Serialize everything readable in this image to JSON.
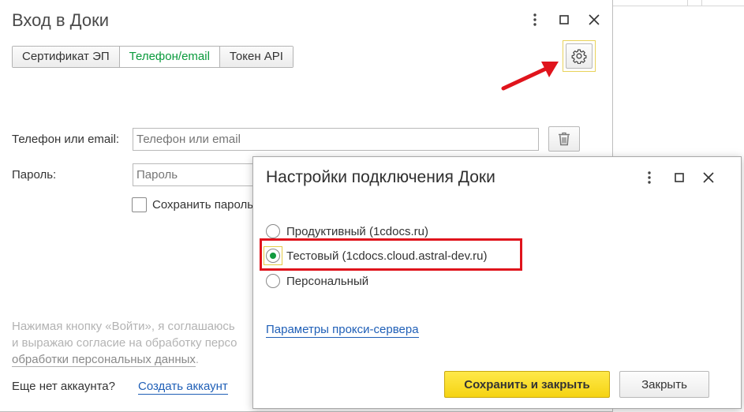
{
  "main_window": {
    "title": "Вход в Доки",
    "tabs": [
      {
        "label": "Сертификат ЭП",
        "active": false
      },
      {
        "label": "Телефон/email",
        "active": true
      },
      {
        "label": "Токен API",
        "active": false
      }
    ],
    "form": {
      "phone_label": "Телефон или email:",
      "phone_placeholder": "Телефон или email",
      "password_label": "Пароль:",
      "password_placeholder": "Пароль",
      "save_password_label": "Сохранить пароль"
    },
    "consent": {
      "line1": "Нажимая кнопку «Войти», я соглашаюсь",
      "line2": "и выражаю согласие на обработку персо",
      "link": "обработки персональных данных",
      "link_suffix": "."
    },
    "no_account_text": "Еще нет аккаунта?",
    "create_account_link": "Создать аккаунт"
  },
  "dialog": {
    "title": "Настройки подключения Доки",
    "options": [
      {
        "label": "Продуктивный (1cdocs.ru)",
        "selected": false
      },
      {
        "label": "Тестовый (1cdocs.cloud.astral-dev.ru)",
        "selected": true
      },
      {
        "label": "Персональный",
        "selected": false
      }
    ],
    "proxy_link": "Параметры прокси-сервера",
    "save_button": "Сохранить и закрыть",
    "close_button": "Закрыть"
  },
  "colors": {
    "active_tab": "#0a9a3c",
    "link": "#1f5fb7",
    "primary_button": "#f5d313",
    "highlight": "#e0141c"
  }
}
